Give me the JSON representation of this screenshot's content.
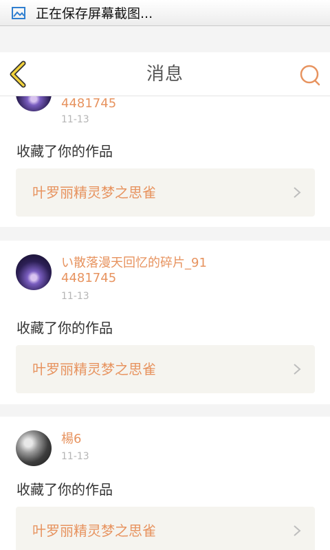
{
  "status_bar": {
    "text": "正在保存屏幕截图...",
    "icon": "image-icon"
  },
  "header": {
    "title": "消息",
    "back_icon": "chevron-left-icon",
    "search_icon": "search-icon"
  },
  "colors": {
    "accent": "#e7935f",
    "back_icon": "#f2d23c",
    "card_bg": "#f5f4ef",
    "page_bg": "#f4f4f4"
  },
  "items": [
    {
      "user": "4481745",
      "time": "11-13",
      "action": "收藏了你的作品",
      "work_title": "叶罗丽精灵梦之思雀"
    },
    {
      "user_line1": "い散落漫天回忆的碎片_91",
      "user_line2": "4481745",
      "time": "11-13",
      "action": "收藏了你的作品",
      "work_title": "叶罗丽精灵梦之思雀"
    },
    {
      "user": "楊6",
      "time": "11-13",
      "action": "收藏了你的作品",
      "work_title": "叶罗丽精灵梦之思雀"
    }
  ]
}
